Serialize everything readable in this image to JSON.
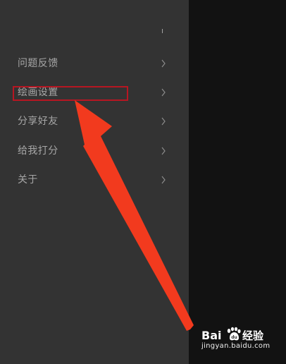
{
  "top_glyph": "ı",
  "menu": {
    "items": [
      {
        "label": "问题反馈"
      },
      {
        "label": "绘画设置"
      },
      {
        "label": "分享好友"
      },
      {
        "label": "给我打分"
      },
      {
        "label": "关于"
      }
    ]
  },
  "watermark": {
    "brand_text": "Bai经验",
    "url_text": "jingyan.baidu.com"
  },
  "colors": {
    "drawer_bg": "#333333",
    "side_bg": "#121212",
    "menu_text": "#a6a6a6",
    "highlight_box": "#b71622",
    "arrow": "#f23a1e"
  },
  "icons": {
    "menu_chevron": "chevron-right-icon",
    "watermark_logo": "baidu-paw-icon",
    "annotation": "annotation-arrow"
  }
}
